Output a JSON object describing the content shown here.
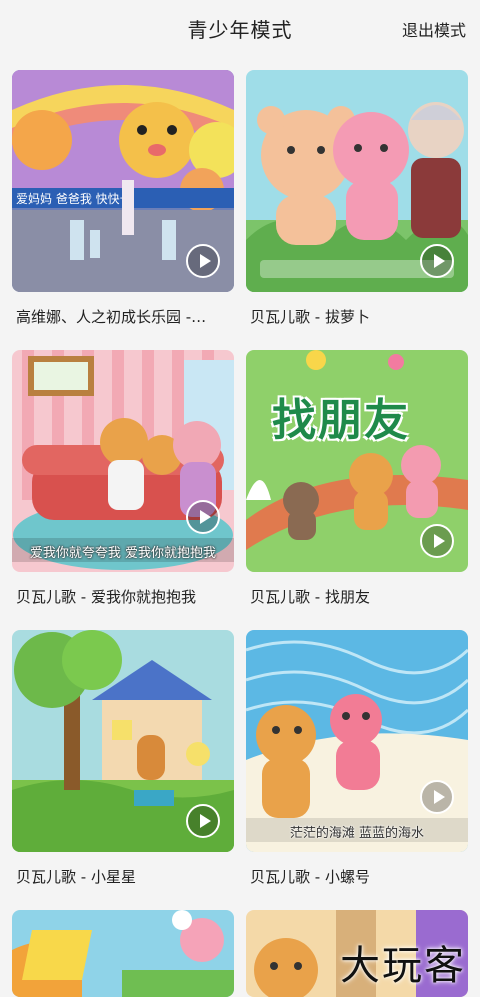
{
  "header": {
    "title": "青少年模式",
    "exit_label": "退出模式"
  },
  "videos": [
    {
      "caption": "高维娜、人之初成长乐园 -…"
    },
    {
      "caption": "贝瓦儿歌 - 拔萝卜"
    },
    {
      "caption": "贝瓦儿歌 - 爱我你就抱抱我",
      "subtitle": "爱我你就夸夸我   爱我你就抱抱我"
    },
    {
      "caption": "贝瓦儿歌 - 找朋友",
      "art_text": "找朋友"
    },
    {
      "caption": "贝瓦儿歌 - 小星星"
    },
    {
      "caption": "贝瓦儿歌 - 小螺号",
      "subtitle": "茫茫的海滩   蓝蓝的海水"
    }
  ],
  "watermark": "大玩客"
}
